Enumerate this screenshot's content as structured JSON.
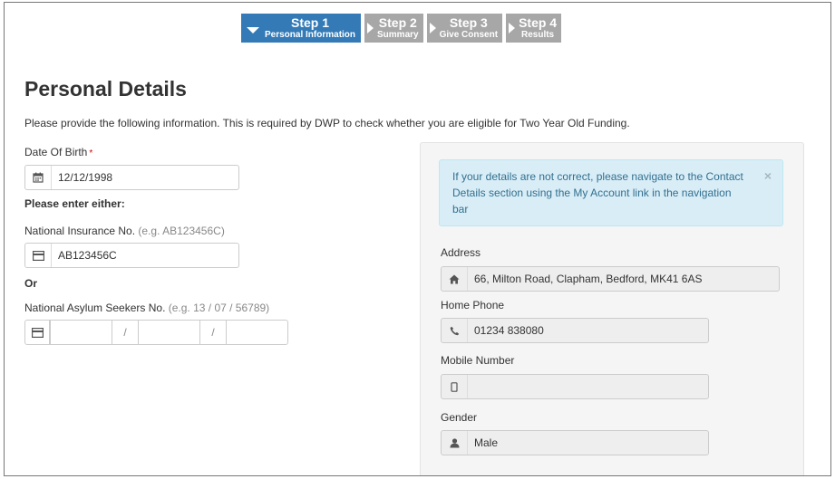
{
  "stepper": [
    {
      "title": "Step 1",
      "subtitle": "Personal Information",
      "active": true
    },
    {
      "title": "Step 2",
      "subtitle": "Summary",
      "active": false
    },
    {
      "title": "Step 3",
      "subtitle": "Give Consent",
      "active": false
    },
    {
      "title": "Step 4",
      "subtitle": "Results",
      "active": false
    }
  ],
  "page": {
    "title": "Personal Details",
    "intro": "Please provide the following information. This is required by DWP to check whether you are eligible for Two Year Old Funding."
  },
  "form": {
    "dob_label": "Date Of Birth",
    "dob_required": "*",
    "dob_value": "12/12/1998",
    "either_label": "Please enter either:",
    "nin_label": "National Insurance No.",
    "nin_hint": "(e.g. AB123456C)",
    "nin_value": "AB123456C",
    "or_label": "Or",
    "nasn_label": "National Asylum Seekers No.",
    "nasn_hint": "(e.g. 13 / 07 / 56789)",
    "nasn_sep": "/"
  },
  "contact": {
    "alert": "If your details are not correct, please navigate to the Contact Details section using the My Account link in the navigation bar",
    "alert_close": "×",
    "address_label": "Address",
    "address_value": "66, Milton Road, Clapham, Bedford, MK41 6AS",
    "home_phone_label": "Home Phone",
    "home_phone_value": "01234 838080",
    "mobile_label": "Mobile Number",
    "mobile_value": "",
    "gender_label": "Gender",
    "gender_value": "Male"
  },
  "colors": {
    "primary": "#337ab7",
    "step_inactive": "#a7a7a7",
    "alert_bg": "#d9edf7",
    "alert_text": "#31708f",
    "required": "#cc0000"
  },
  "icons": {
    "dob": "calendar-icon",
    "nin": "id-card-icon",
    "nasn": "id-card-icon",
    "address": "home-icon",
    "home_phone": "phone-icon",
    "mobile": "mobile-icon",
    "gender": "user-icon"
  }
}
